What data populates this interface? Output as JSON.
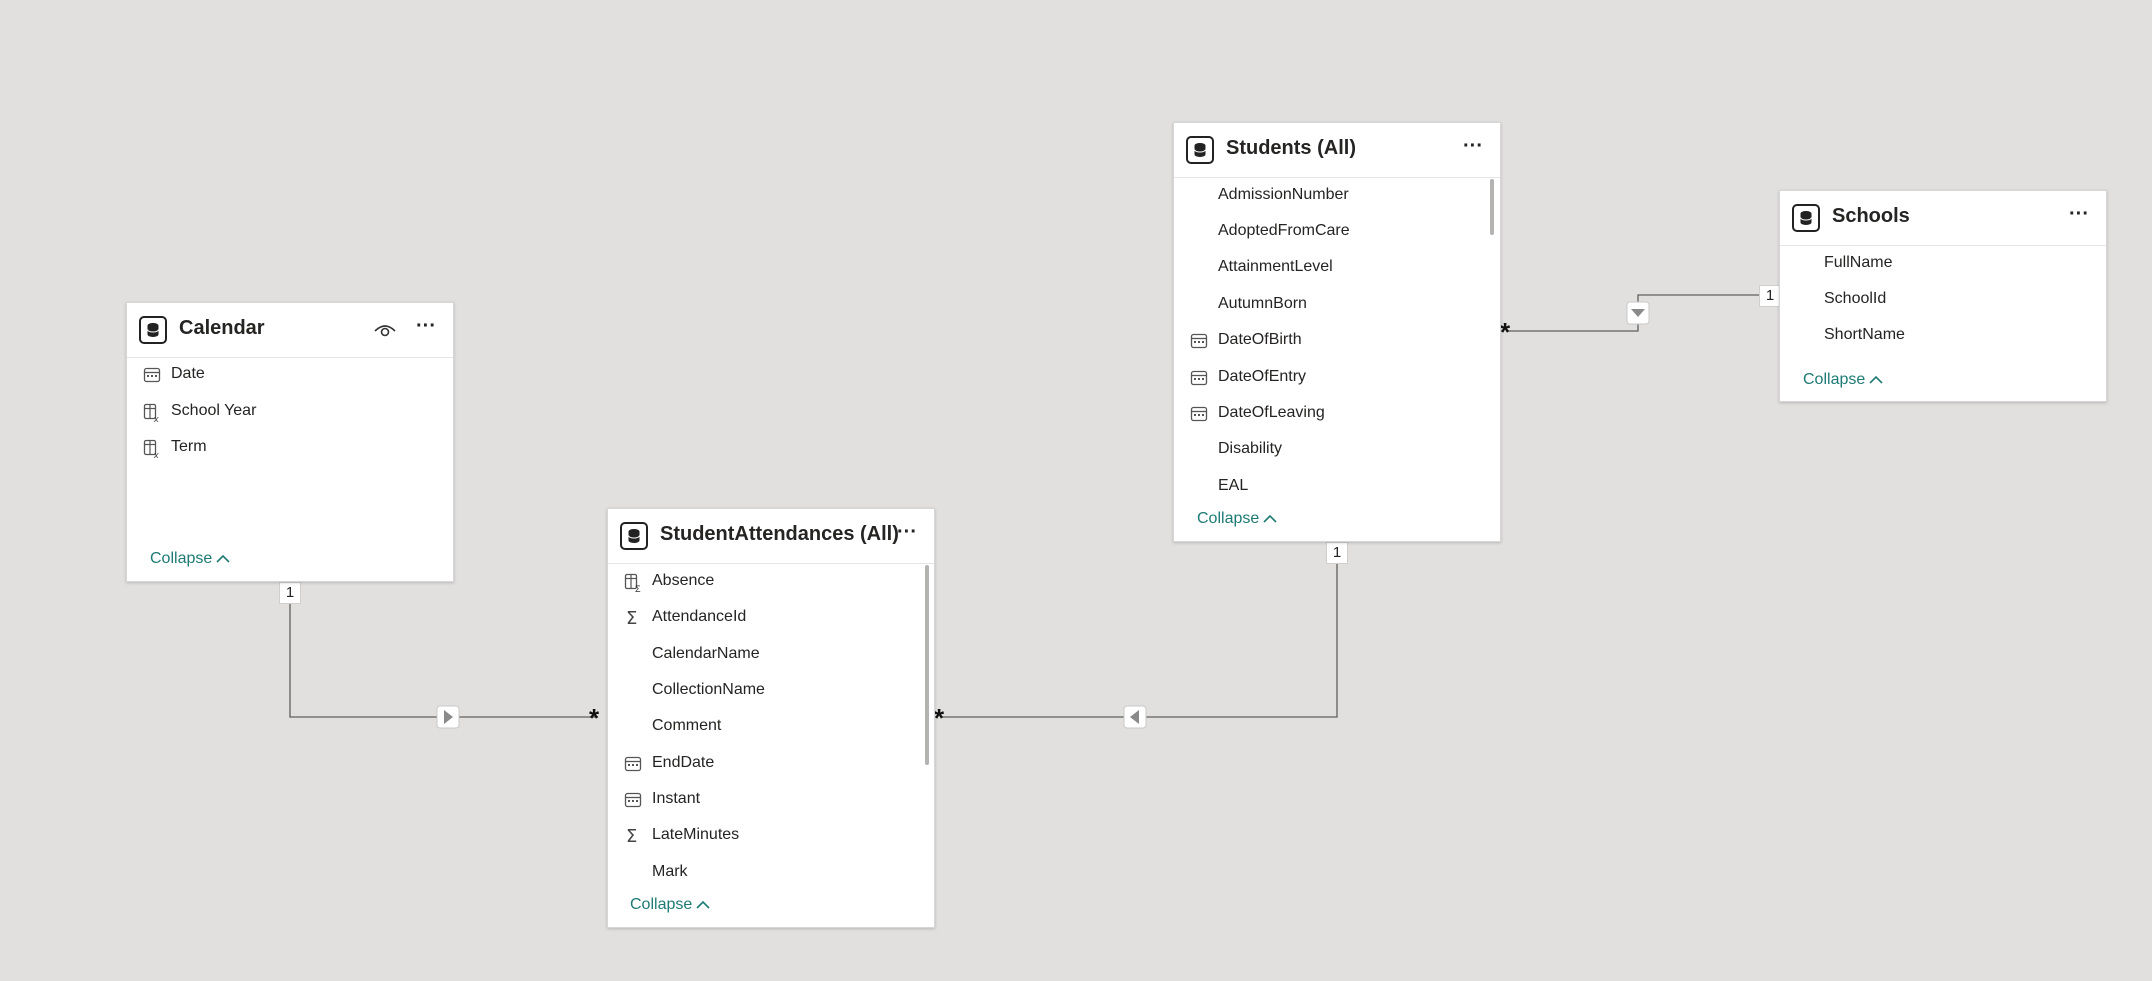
{
  "tables": {
    "calendar": {
      "title": "Calendar",
      "fields": [
        {
          "name": "Date",
          "icon": "calendar-icon"
        },
        {
          "name": "School Year",
          "icon": "calculated-column-icon"
        },
        {
          "name": "Term",
          "icon": "calculated-column-icon"
        }
      ],
      "collapse_label": "Collapse",
      "more": "···"
    },
    "student_attendances": {
      "title": "StudentAttendances (All)",
      "fields": [
        {
          "name": "Absence",
          "icon": "calculated-column-icon"
        },
        {
          "name": "AttendanceId",
          "icon": "sigma-icon"
        },
        {
          "name": "CalendarName",
          "icon": ""
        },
        {
          "name": "CollectionName",
          "icon": ""
        },
        {
          "name": "Comment",
          "icon": ""
        },
        {
          "name": "EndDate",
          "icon": "calendar-icon"
        },
        {
          "name": "Instant",
          "icon": "calendar-icon"
        },
        {
          "name": "LateMinutes",
          "icon": "sigma-icon"
        },
        {
          "name": "Mark",
          "icon": ""
        }
      ],
      "collapse_label": "Collapse",
      "more": "···"
    },
    "students": {
      "title": "Students (All)",
      "fields": [
        {
          "name": "AdmissionNumber",
          "icon": ""
        },
        {
          "name": "AdoptedFromCare",
          "icon": ""
        },
        {
          "name": "AttainmentLevel",
          "icon": ""
        },
        {
          "name": "AutumnBorn",
          "icon": ""
        },
        {
          "name": "DateOfBirth",
          "icon": "calendar-icon"
        },
        {
          "name": "DateOfEntry",
          "icon": "calendar-icon"
        },
        {
          "name": "DateOfLeaving",
          "icon": "calendar-icon"
        },
        {
          "name": "Disability",
          "icon": ""
        },
        {
          "name": "EAL",
          "icon": ""
        }
      ],
      "collapse_label": "Collapse",
      "more": "···"
    },
    "schools": {
      "title": "Schools",
      "fields": [
        {
          "name": "FullName",
          "icon": ""
        },
        {
          "name": "SchoolId",
          "icon": ""
        },
        {
          "name": "ShortName",
          "icon": ""
        }
      ],
      "collapse_label": "Collapse",
      "more": "···"
    }
  },
  "relationships": {
    "calendar_to_attendances": {
      "from_label": "1",
      "to_label": "*"
    },
    "students_to_attendances": {
      "from_label": "1",
      "to_label": "*"
    },
    "students_to_schools": {
      "from_label": "*",
      "to_label": "1"
    }
  },
  "colors": {
    "canvas": "#e1e0df",
    "link": "#5f5f5f",
    "collapse": "#1d7a74"
  }
}
